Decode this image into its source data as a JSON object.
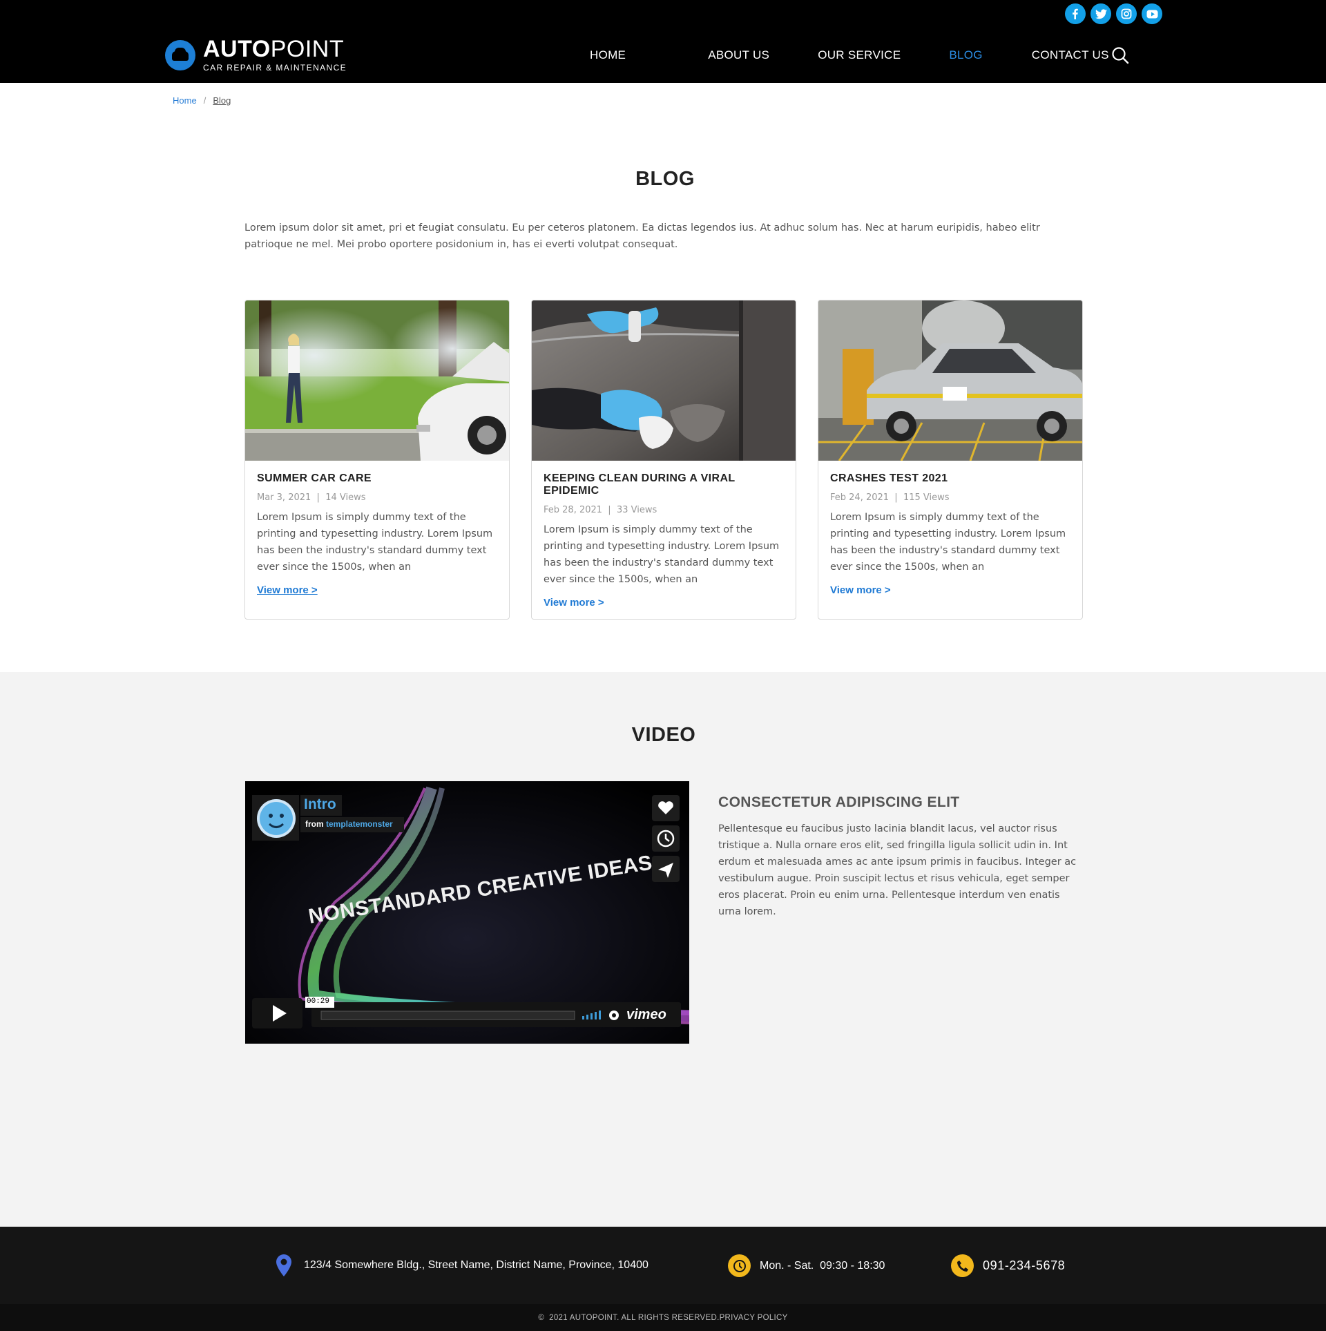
{
  "header": {
    "logo_bold": "AUTO",
    "logo_light": "POINT",
    "logo_sub": "CAR REPAIR & MAINTENANCE",
    "nav": [
      "HOME",
      "ABOUT US",
      "OUR SERVICE",
      "BLOG",
      "CONTACT US"
    ],
    "active_nav": "BLOG",
    "social_icons": [
      "facebook-icon",
      "twitter-icon",
      "instagram-icon",
      "youtube-icon"
    ],
    "accent_color": "#2b8ee6"
  },
  "breadcrumb": {
    "home": "Home",
    "separator": "/",
    "current": "Blog"
  },
  "blog": {
    "title": "BLOG",
    "intro": "Lorem ipsum dolor sit amet, pri et feugiat consulatu. Eu per ceteros platonem. Ea dictas legendos ius. At adhuc solum has. Nec at harum euripidis, habeo elitr patrioque ne mel. Mei probo oportere posidonium in, has ei everti volutpat consequat.",
    "posts": [
      {
        "title": "SUMMER CAR CARE",
        "date": "Mar 3, 2021",
        "views": "14 Views",
        "excerpt": "Lorem Ipsum is simply dummy text of the printing and typesetting industry. Lorem Ipsum has been the industry's standard dummy text ever since the 1500s, when an",
        "link": "View more >"
      },
      {
        "title": "KEEPING CLEAN DURING A VIRAL EPIDEMIC",
        "date": "Feb 28, 2021",
        "views": "33 Views",
        "excerpt": "Lorem Ipsum is simply dummy text of the printing and typesetting industry. Lorem Ipsum has been the industry's standard dummy text ever since the 1500s, when an",
        "link": "View more >"
      },
      {
        "title": "CRASHES TEST 2021",
        "date": "Feb 24, 2021",
        "views": "115 Views",
        "excerpt": "Lorem Ipsum is simply dummy text of the printing and typesetting industry. Lorem Ipsum has been the industry's standard dummy text ever since the 1500s, when an",
        "link": "View more >"
      }
    ]
  },
  "video": {
    "title": "VIDEO",
    "player": {
      "video_title": "Intro",
      "from_label": "from",
      "channel": "templatemonster",
      "overlay_text": "NONSTANDARD CREATIVE IDEAS",
      "duration": "00:29",
      "brand": "vimeo"
    },
    "heading": "CONSECTETUR ADIPISCING ELIT",
    "text": "Pellentesque eu faucibus justo lacinia blandit lacus, vel auctor risus tristique a. Nulla ornare eros elit, sed fringilla ligula sollicit udin in. Int erdum et malesuada ames ac ante ipsum primis in faucibus. Integer ac vestibulum augue. Proin suscipit lectus et risus vehicula, eget semper eros placerat. Proin eu enim urna. Pellentesque interdum ven enatis urna lorem."
  },
  "footer": {
    "address": "123/4 Somewhere Bldg., Street Name, District Name, Province, 10400",
    "hours": "Mon. - Sat.  09:30 - 18:30",
    "phone": "091-234-5678",
    "copyright": "©  2021 AUTOPOINT. ALL RIGHTS RESERVED.PRIVACY POLICY",
    "icon_color": "#f2b81c"
  }
}
